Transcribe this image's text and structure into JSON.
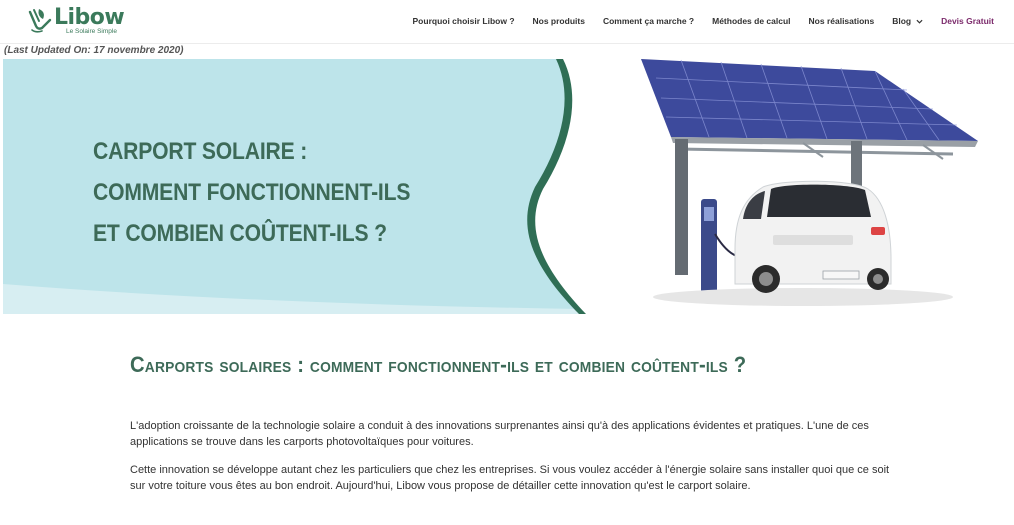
{
  "brand": {
    "name": "Libow",
    "tagline": "Le Solaire Simple",
    "color": "#3b7a5b",
    "icon": "leaf-hand-icon"
  },
  "nav": {
    "items": [
      {
        "label": "Pourquoi choisir Libow ?"
      },
      {
        "label": "Nos produits"
      },
      {
        "label": "Comment ça marche ?"
      },
      {
        "label": "Méthodes de calcul"
      },
      {
        "label": "Nos réalisations"
      },
      {
        "label": "Blog"
      }
    ],
    "cta": "Devis Gratuit",
    "cta_color": "#7b2a6b"
  },
  "updated": "(Last Updated On: 17 novembre 2020)",
  "hero": {
    "title_lines": [
      "CARPORT SOLAIRE :",
      "COMMENT FONCTIONNENT-ILS",
      "ET COMBIEN COÛTENT-ILS ?"
    ],
    "panel_color": "#bde4ea",
    "accent_color": "#2f6e55"
  },
  "article": {
    "title": "Carports solaires : comment fonctionnent-ils et combien coûtent-ils ?",
    "paragraphs": [
      "L'adoption croissante de la technologie solaire a conduit à des innovations surprenantes ainsi qu'à des applications évidentes et pratiques. L'une de ces applications se trouve dans les carports photovoltaïques pour voitures.",
      "Cette innovation se développe autant chez les particuliers que chez les entreprises. Si vous voulez accéder à l'énergie solaire sans installer quoi que ce soit sur votre toiture vous êtes au bon endroit. Aujourd'hui, Libow vous propose de détailler cette innovation qu'est le carport solaire."
    ]
  }
}
